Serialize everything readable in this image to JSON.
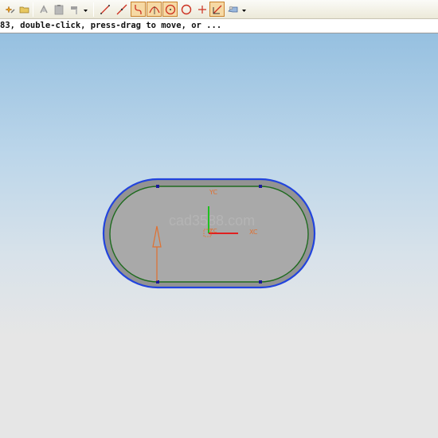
{
  "toolbar": {
    "buttons": [
      {
        "icon": "sparkle-pencil-icon",
        "active": false
      },
      {
        "icon": "folder-icon",
        "active": false
      },
      {
        "icon": "transform-icon",
        "active": false
      },
      {
        "icon": "clipboard-icon",
        "active": false
      },
      {
        "icon": "hammer-icon",
        "active": false
      },
      {
        "icon": "line-icon",
        "active": false
      },
      {
        "icon": "line-through-point-icon",
        "active": false
      },
      {
        "icon": "fillet-arc-icon",
        "active": true
      },
      {
        "icon": "arc-three-point-icon",
        "active": true
      },
      {
        "icon": "arc-center-icon",
        "active": true
      },
      {
        "icon": "circle-icon",
        "active": false
      },
      {
        "icon": "point-icon",
        "active": false
      },
      {
        "icon": "quick-trim-icon",
        "active": true
      },
      {
        "icon": "constraint-icon",
        "active": false
      }
    ]
  },
  "cue_line": {
    "text": "83, double-click, press-drag to move, or ..."
  },
  "viewport": {
    "watermark": "cad3588.com",
    "axis_labels": {
      "yc": "YC",
      "xc": "XC",
      "zc": "ZC"
    },
    "colors": {
      "outer_profile": "#2244dd",
      "inner_profile": "#1f6b1f",
      "slot_fill": "#a9a9a9",
      "slot_rim": "#8f8f8f",
      "x_axis": "#e02020",
      "y_axis": "#20c020",
      "orientation_arrow": "#e07030",
      "control_point": "#1a1a9a",
      "axis_label": "#e07030"
    }
  }
}
